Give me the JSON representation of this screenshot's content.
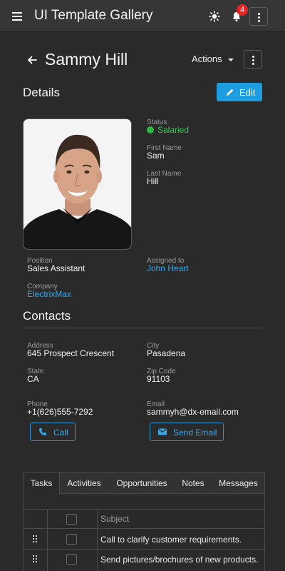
{
  "header": {
    "app_title": "UI Template Gallery",
    "notification_count": "4",
    "icons": [
      "menu-icon",
      "sun-icon",
      "bell-icon",
      "more-vert-icon"
    ]
  },
  "profile": {
    "name": "Sammy Hill",
    "actions_label": "Actions"
  },
  "details": {
    "title": "Details",
    "edit_label": "Edit",
    "status_label": "Status",
    "status_value": "Salaried",
    "status_color": "#2eb84b",
    "first_name_label": "First Name",
    "first_name": "Sam",
    "last_name_label": "Last Name",
    "last_name": "Hill",
    "position_label": "Position",
    "position": "Sales Assistant",
    "assigned_label": "Assigned to",
    "assigned_to": "John Heart",
    "company_label": "Company",
    "company": "ElectrixMax"
  },
  "contacts": {
    "title": "Contacts",
    "address_label": "Address",
    "address": "645 Prospect Crescent",
    "city_label": "City",
    "city": "Pasadena",
    "state_label": "State",
    "state": "CA",
    "zip_label": "Zip Code",
    "zip": "91103",
    "phone_label": "Phone",
    "phone": "+1(626)555-7292",
    "email_label": "Email",
    "email": "sammyh@dx-email.com",
    "call_label": "Call",
    "send_email_label": "Send Email"
  },
  "tabs": {
    "items": [
      "Tasks",
      "Activities",
      "Opportunities",
      "Notes",
      "Messages"
    ],
    "active": "Tasks"
  },
  "tasks_grid": {
    "subject_header": "Subject",
    "rows": [
      "Call to clarify customer requirements.",
      "Send pictures/brochures of new products."
    ]
  },
  "colors": {
    "accent": "#1e9ee0",
    "link": "#35a8e8",
    "badge": "#e32525",
    "background": "#2a2a2a",
    "toolbar": "#363636"
  }
}
